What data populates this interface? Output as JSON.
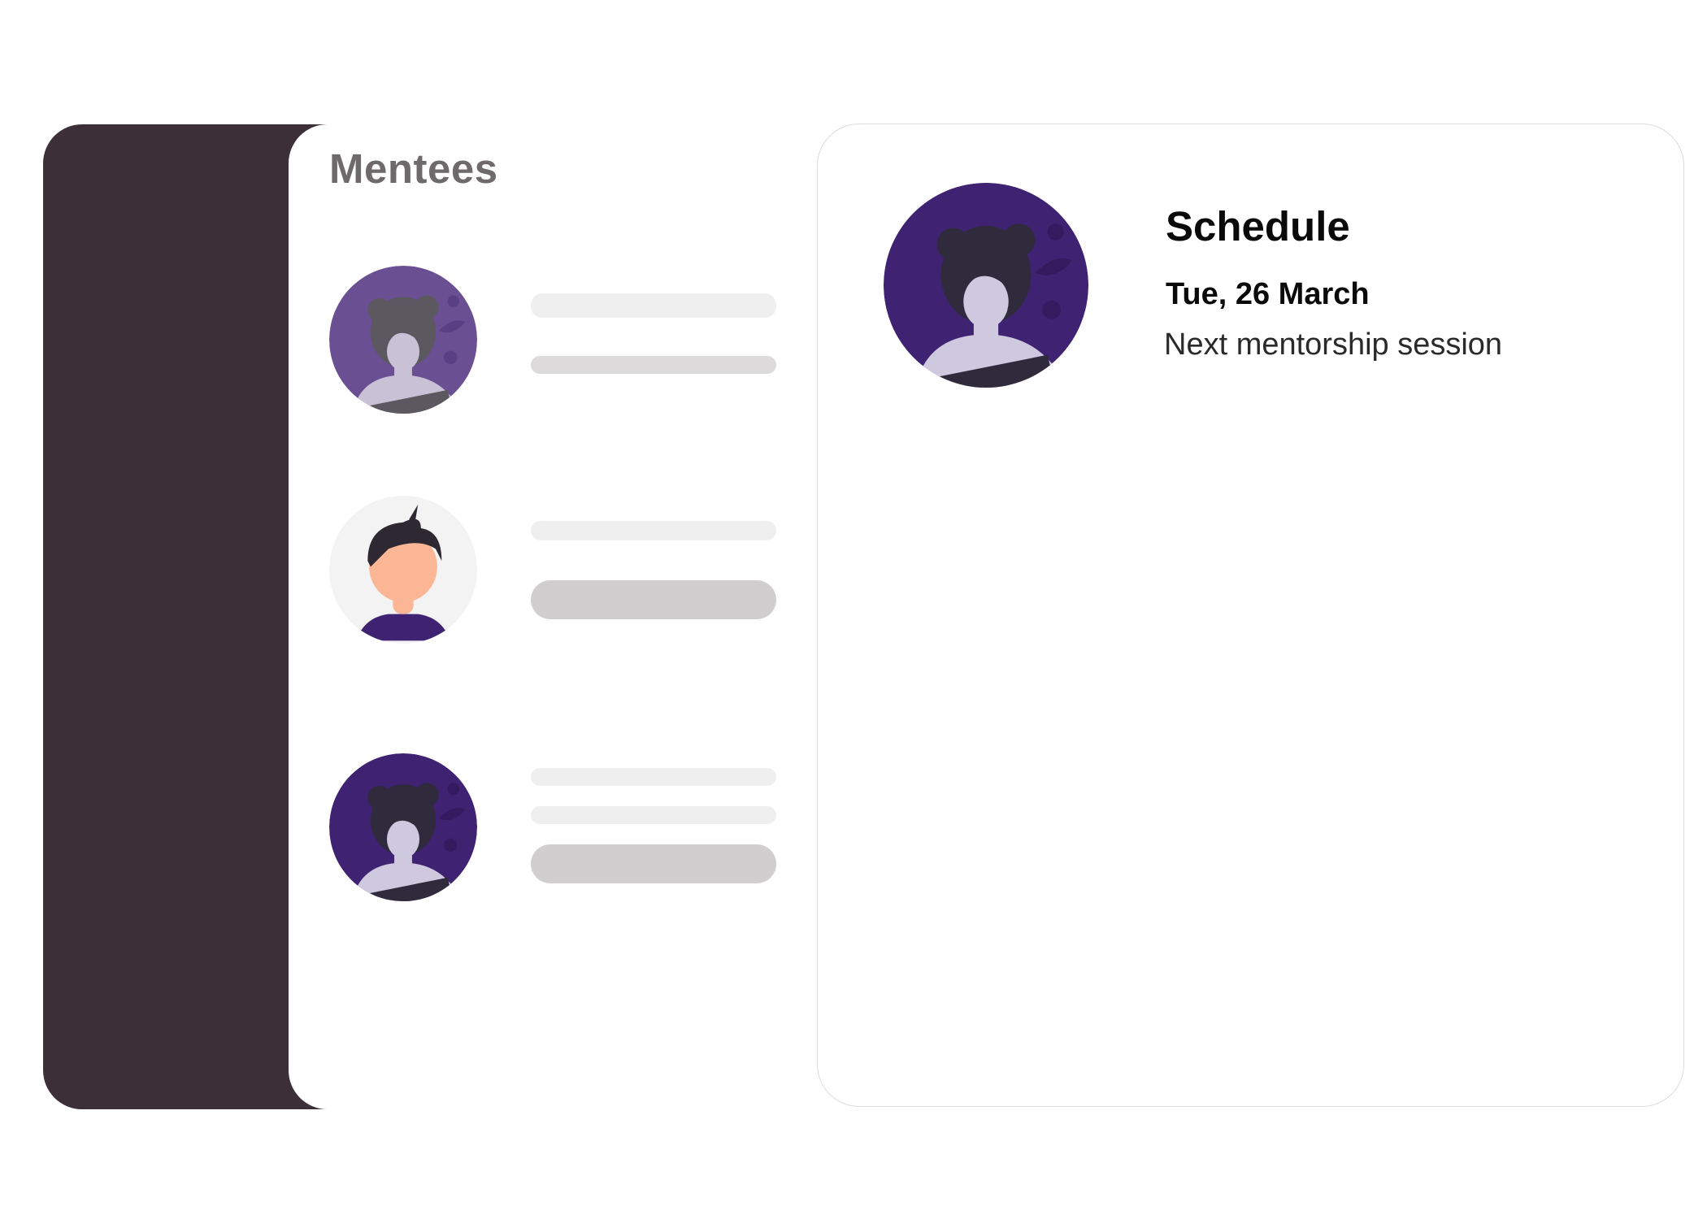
{
  "mentees": {
    "title": "Mentees",
    "items": [
      {
        "avatar": "woman-with-buns-avatar-icon",
        "avatar_bg": "#6b4f93",
        "faded": true
      },
      {
        "avatar": "man-avatar-icon",
        "avatar_bg": "#f3f3f3",
        "faded": false
      },
      {
        "avatar": "woman-with-buns-avatar-icon",
        "avatar_bg": "#3f2271",
        "faded": false
      }
    ]
  },
  "schedule": {
    "title": "Schedule",
    "date": "Tue, 26 March",
    "subtitle": "Next mentorship session",
    "avatar": "woman-with-buns-avatar-icon",
    "avatar_bg": "#3f2271"
  },
  "colors": {
    "sidebar": "#3d2f38",
    "accent_purple": "#3f2271",
    "placeholder_light": "#f0eff0",
    "placeholder_mid": "#dcdadb",
    "placeholder_pill": "#d1cecf"
  }
}
